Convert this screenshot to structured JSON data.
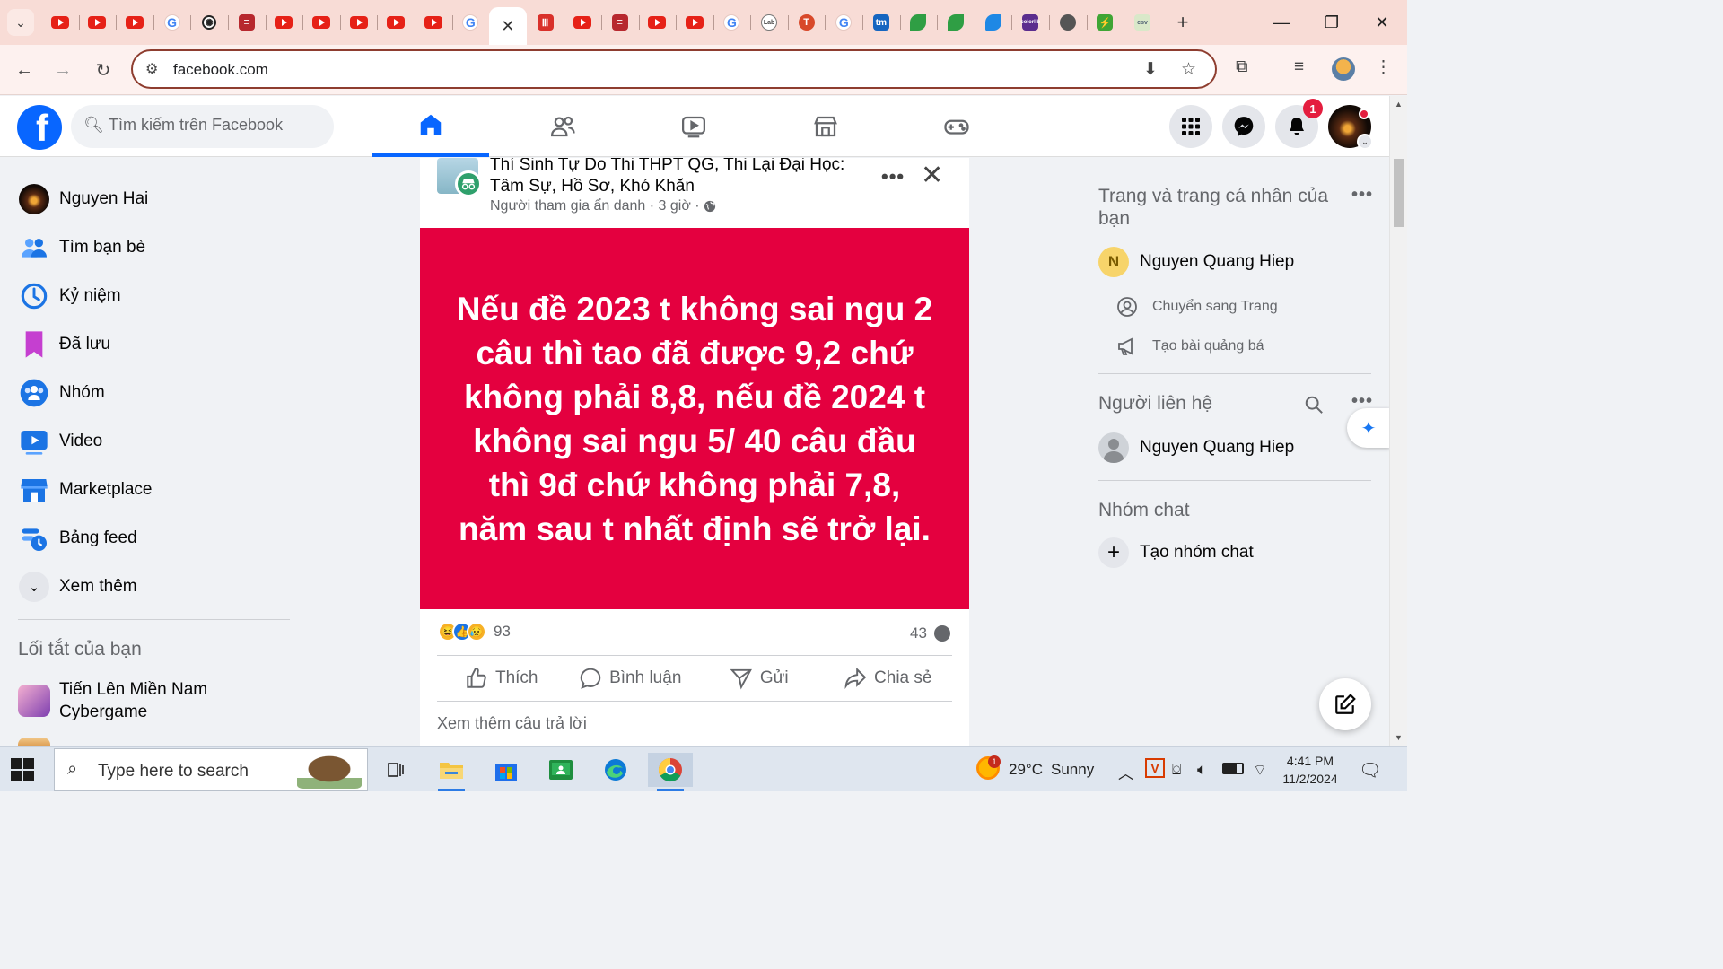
{
  "browser": {
    "tabs": [
      {
        "icon": "youtube-icon",
        "kind": "yt"
      },
      {
        "icon": "youtube-icon",
        "kind": "yt"
      },
      {
        "icon": "youtube-icon",
        "kind": "yt"
      },
      {
        "icon": "google-icon",
        "kind": "g",
        "glyph": "G"
      },
      {
        "icon": "chatgpt-icon",
        "kind": "gpt",
        "glyph": "✺"
      },
      {
        "icon": "document-icon",
        "kind": "doc",
        "glyph": "≡"
      },
      {
        "icon": "youtube-icon",
        "kind": "yt"
      },
      {
        "icon": "youtube-icon",
        "kind": "yt"
      },
      {
        "icon": "youtube-icon",
        "kind": "yt"
      },
      {
        "icon": "youtube-icon",
        "kind": "yt"
      },
      {
        "icon": "youtube-icon",
        "kind": "yt"
      },
      {
        "icon": "google-icon",
        "kind": "g",
        "glyph": "G"
      },
      {
        "icon": "close-tab-icon",
        "kind": "x",
        "glyph": "✕",
        "active": true
      },
      {
        "icon": "bars-icon",
        "kind": "red",
        "glyph": "Ⅲ"
      },
      {
        "icon": "youtube-icon",
        "kind": "yt"
      },
      {
        "icon": "document-icon",
        "kind": "doc",
        "glyph": "≡"
      },
      {
        "icon": "youtube-icon",
        "kind": "yt"
      },
      {
        "icon": "youtube-icon",
        "kind": "yt"
      },
      {
        "icon": "google-icon",
        "kind": "g",
        "glyph": "G"
      },
      {
        "icon": "lab-icon",
        "kind": "lab",
        "glyph": "Lab"
      },
      {
        "icon": "t-circle-icon",
        "kind": "tt",
        "glyph": "T"
      },
      {
        "icon": "google-icon",
        "kind": "g",
        "glyph": "G"
      },
      {
        "icon": "tm-icon",
        "kind": "tm",
        "glyph": "tm"
      },
      {
        "icon": "leaf-icon",
        "kind": "leaf",
        "glyph": ""
      },
      {
        "icon": "leaf-icon",
        "kind": "leaf",
        "glyph": ""
      },
      {
        "icon": "bird-icon",
        "kind": "bird",
        "glyph": ""
      },
      {
        "icon": "colorlib-icon",
        "kind": "purple",
        "glyph": "colorlib"
      },
      {
        "icon": "globe-icon",
        "kind": "globe",
        "glyph": ""
      },
      {
        "icon": "bolt-icon",
        "kind": "green",
        "glyph": "⚡"
      },
      {
        "icon": "csv-icon",
        "kind": "csv",
        "glyph": "csv"
      }
    ],
    "url": "facebook.com"
  },
  "fb": {
    "search_placeholder": "Tìm kiếm trên Facebook",
    "notification_count": "1",
    "left_nav": [
      {
        "label": "Nguyen Hai",
        "icon": "profile-avatar-icon"
      },
      {
        "label": "Tìm bạn bè",
        "icon": "friends-icon"
      },
      {
        "label": "Kỷ niệm",
        "icon": "memories-clock-icon"
      },
      {
        "label": "Đã lưu",
        "icon": "saved-bookmark-icon"
      },
      {
        "label": "Nhóm",
        "icon": "groups-icon"
      },
      {
        "label": "Video",
        "icon": "video-icon"
      },
      {
        "label": "Marketplace",
        "icon": "marketplace-icon"
      },
      {
        "label": "Bảng feed",
        "icon": "feeds-icon"
      },
      {
        "label": "Xem thêm",
        "icon": "chevron-down-icon"
      }
    ],
    "shortcuts_heading": "Lối tắt của bạn",
    "shortcuts": [
      {
        "label_line1": "Tiến Lên Miền Nam",
        "label_line2": "Cybergame"
      }
    ],
    "post": {
      "group_name": "Thí Sinh Tự Do Thi THPT QG, Thi Lại Đại Học: Tâm Sự, Hồ Sơ, Khó Khăn",
      "author": "Người tham gia ẩn danh",
      "time": "3 giờ",
      "body": "Nếu đề 2023 t không sai ngu 2 câu thì tao đã được 9,2 chứ không phải 8,8, nếu đề 2024 t không sai ngu 5/ 40 câu đầu thì 9đ chứ không phải 7,8, năm sau t nhất định sẽ trở lại.",
      "body_color": "#e4003f",
      "reaction_count": "93",
      "comment_count": "43",
      "actions": {
        "like": "Thích",
        "comment": "Bình luận",
        "send": "Gửi",
        "share": "Chia sẻ"
      },
      "see_more": "Xem thêm câu trả lời"
    },
    "right": {
      "pages_heading": "Trang và trang cá nhân của bạn",
      "page_name": "Nguyen Quang Hiep",
      "page_initial": "N",
      "switch_label": "Chuyển sang Trang",
      "promo_label": "Tạo bài quảng bá",
      "contacts_heading": "Người liên hệ",
      "contact_name": "Nguyen Quang Hiep",
      "group_chat_heading": "Nhóm chat",
      "create_group_label": "Tạo nhóm chat"
    }
  },
  "taskbar": {
    "search_placeholder": "Type here to search",
    "weather_temp": "29°C",
    "weather_text": "Sunny",
    "weather_badge": "1",
    "time": "4:41 PM",
    "date": "11/2/2024"
  },
  "colors": {
    "fb_blue": "#0866ff",
    "post_red": "#e4003f",
    "tab_strip": "#f8dcd6"
  }
}
